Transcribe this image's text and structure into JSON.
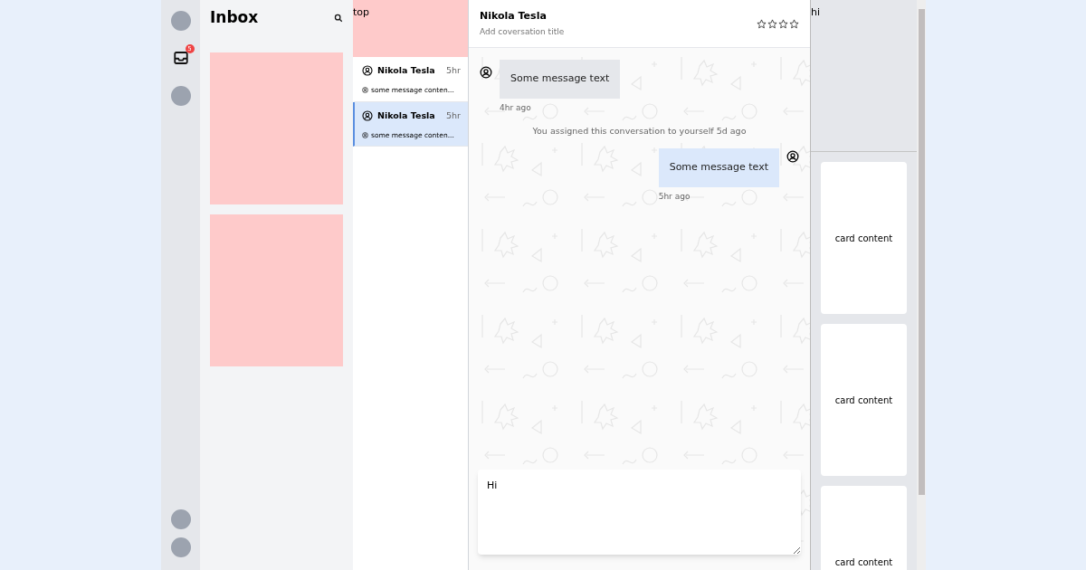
{
  "rail": {
    "inbox_badge": "5"
  },
  "inbox": {
    "title": "Inbox"
  },
  "conversation_list": {
    "top_label": "top",
    "items": [
      {
        "name": "Nikola Tesla",
        "time": "5hr",
        "preview": "some message conten...",
        "selected": false
      },
      {
        "name": "Nikola Tesla",
        "time": "5hr",
        "preview": "some message conten...",
        "selected": true
      }
    ]
  },
  "chat": {
    "contact": "Nikola Tesla",
    "subtitle": "Add coversation title",
    "stars": 0,
    "messages": [
      {
        "kind": "incoming",
        "text": "Some message text",
        "time": "4hr ago"
      },
      {
        "kind": "system",
        "text": "You assigned this conversation to yourself 5d ago"
      },
      {
        "kind": "outgoing",
        "text": "Some message text",
        "time": "5hr ago"
      }
    ],
    "composer": {
      "value": "Hi"
    }
  },
  "side_panel": {
    "label": "hi",
    "cards": [
      "card content",
      "card content",
      "card content"
    ]
  }
}
